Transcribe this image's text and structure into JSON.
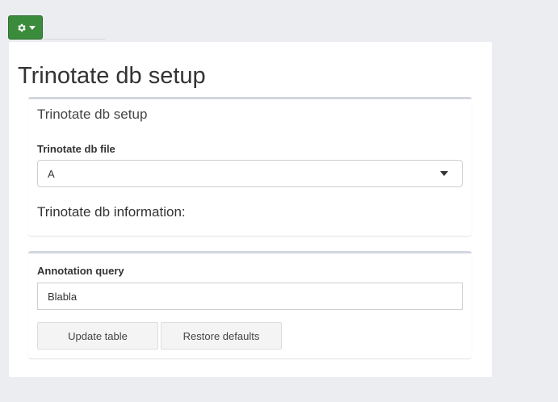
{
  "toolbar": {
    "settings_icon": "gear-icon",
    "dropdown_icon": "caret-down-icon",
    "accent_color": "#3b8b3c"
  },
  "page": {
    "title": "Trinotate db setup"
  },
  "setup_box": {
    "title": "Trinotate db setup",
    "db_file_label": "Trinotate db file",
    "db_file_value": "A",
    "info_heading": "Trinotate db information:"
  },
  "query_box": {
    "label": "Annotation query",
    "value": "Blabla",
    "update_button": "Update table",
    "restore_button": "Restore defaults"
  }
}
